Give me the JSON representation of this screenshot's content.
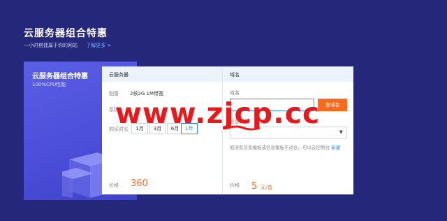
{
  "banner": {
    "title": "云服务器组合特惠",
    "subtitle": "一小时搭建属于你的网站",
    "more_link": "了解更多 >"
  },
  "promo": {
    "title": "云服务器组合特惠",
    "subtitle": "100%CPU性能"
  },
  "server_section": {
    "header": "云服务器",
    "config_label": "配置",
    "config_value": "2核2G  1M带宽",
    "system_label": "系统",
    "duration_label": "购买时长",
    "durations": [
      "1月",
      "3月",
      "6月",
      "1年"
    ],
    "selected_duration": "1年",
    "price_label": "价格",
    "price_value": "360"
  },
  "domain_section": {
    "header": "域名",
    "domain_label": "域名",
    "search_button": "查域名",
    "template_label": "信息模板",
    "note_text": "如没有信息模板或信息模板不适合，可以去控制台",
    "note_link": "新建",
    "price_label": "价格",
    "price_value": "5",
    "price_unit": "元/首"
  },
  "watermark": "www.zjcp.cc",
  "colors": {
    "background": "#25287a",
    "promo": "#5b5fe6",
    "accent": "#2e8cf0",
    "price": "#ff6a1a",
    "watermark": "#e8181b"
  }
}
